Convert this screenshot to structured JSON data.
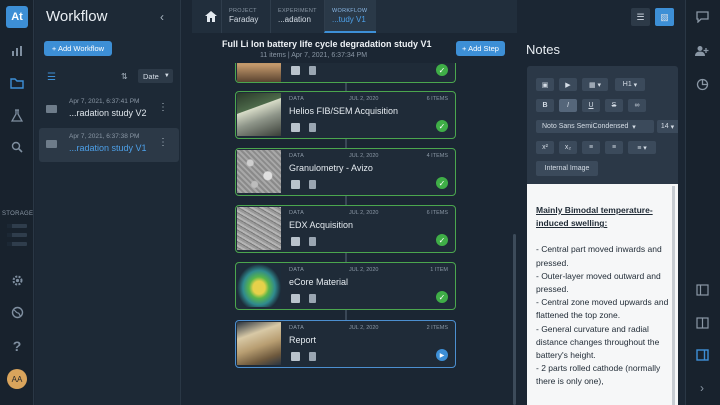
{
  "app": {
    "logo": "At"
  },
  "rail": {
    "icons": [
      "chart-icon",
      "folder-icon",
      "flask-icon",
      "search-icon",
      "gear-icon",
      "globe-icon",
      "help-icon"
    ],
    "storage_label": "STORAGE",
    "storage_levels": [
      0.75,
      0.75,
      0.75
    ],
    "avatar": "AA"
  },
  "workflow_panel": {
    "title": "Workflow",
    "add_button": "+ Add Workflow",
    "sort_select": "Date",
    "items": [
      {
        "date": "Apr 7, 2021, 6:37:41 PM",
        "name": "...radation study V2"
      },
      {
        "date": "Apr 7, 2021, 6:37:38 PM",
        "name": "...radation study V1"
      }
    ]
  },
  "breadcrumb": {
    "project_label": "PROJECT",
    "project_value": "Faraday",
    "experiment_label": "EXPERIMENT",
    "experiment_value": "...adation",
    "workflow_label": "WORKFLOW",
    "workflow_value": "...tudy V1"
  },
  "study": {
    "title": "Full Li Ion battery life cycle degradation study V1",
    "meta": "11 items  |  Apr 7, 2021, 6:37:34 PM",
    "add_step": "+ Add Step"
  },
  "steps": [
    {
      "kind": "DATA",
      "date": "JUL 2, 2020",
      "items": "6 ITEMS",
      "name": "Helios FIB/SEM Acquisition",
      "status": "done"
    },
    {
      "kind": "DATA",
      "date": "JUL 2, 2020",
      "items": "4 ITEMS",
      "name": "Granulometry - Avizo",
      "status": "done"
    },
    {
      "kind": "DATA",
      "date": "JUL 2, 2020",
      "items": "6 ITEMS",
      "name": "EDX Acquisition",
      "status": "done"
    },
    {
      "kind": "DATA",
      "date": "JUL 2, 2020",
      "items": "1 ITEM",
      "name": "eCore Material",
      "status": "done"
    },
    {
      "kind": "DATA",
      "date": "JUL 2, 2020",
      "items": "2 ITEMS",
      "name": "Report",
      "status": "running"
    }
  ],
  "notes": {
    "title": "Notes",
    "heading_select": "H1",
    "font_select": "Noto Sans SemiCondensed",
    "size_select": "14",
    "internal_image": "Internal Image",
    "heading": "Mainly Bimodal temperature-induced swelling:",
    "lines": [
      "- Central part moved inwards and pressed.",
      "- Outer-layer moved outward and pressed.",
      "- Central zone moved upwards and flattened the top zone.",
      "- General curvature and radial distance changes throughout the battery's height.",
      "- 2 parts rolled cathode (normally there is only one),"
    ]
  },
  "colors": {
    "accent": "#3d8fd6",
    "success": "#3fae47",
    "panel": "#1d2936"
  }
}
